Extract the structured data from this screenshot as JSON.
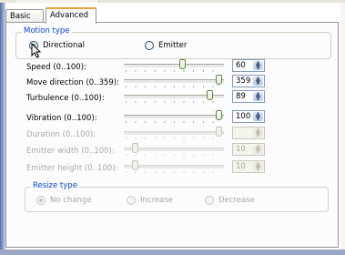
{
  "tabs": [
    {
      "label": "Basic",
      "active": false
    },
    {
      "label": "Advanced",
      "active": true
    }
  ],
  "motion_type": {
    "title": "Motion type",
    "options": [
      {
        "label": "Directional",
        "selected": true
      },
      {
        "label": "Emitter",
        "selected": false
      }
    ]
  },
  "params": [
    {
      "label": "Speed (0..100):",
      "value": "60",
      "enabled": true
    },
    {
      "label": "Move direction (0..359):",
      "value": "359",
      "enabled": true
    },
    {
      "label": "Turbulence (0..100):",
      "value": "89",
      "enabled": true
    },
    {
      "label": "Vibration (0..100):",
      "value": "100",
      "enabled": true
    },
    {
      "label": "Duration (0..100):",
      "value": "",
      "enabled": false
    },
    {
      "label": "Emitter width (0..100):",
      "value": "10",
      "enabled": false
    },
    {
      "label": "Emitter height (0..100):",
      "value": "10",
      "enabled": false
    }
  ],
  "slider_levels": {
    "speed": 0.6,
    "move_direction": 1.0,
    "turbulence": 0.89,
    "vibration": 1.0,
    "duration": 1.0,
    "emitter_width": 0.1,
    "emitter_height": 0.1
  },
  "resize_type": {
    "title": "Resize type",
    "options": [
      {
        "label": "No change",
        "selected": true
      },
      {
        "label": "Increase",
        "selected": false
      },
      {
        "label": "Decrease",
        "selected": false
      }
    ]
  },
  "icons": {
    "spin": "spin-up-down-icon",
    "cursor": "mouse-pointer-icon"
  },
  "colors": {
    "group_title": "#0046d5",
    "active_tab_accent": "#e8a33a",
    "disabled_text": "#aca899"
  }
}
